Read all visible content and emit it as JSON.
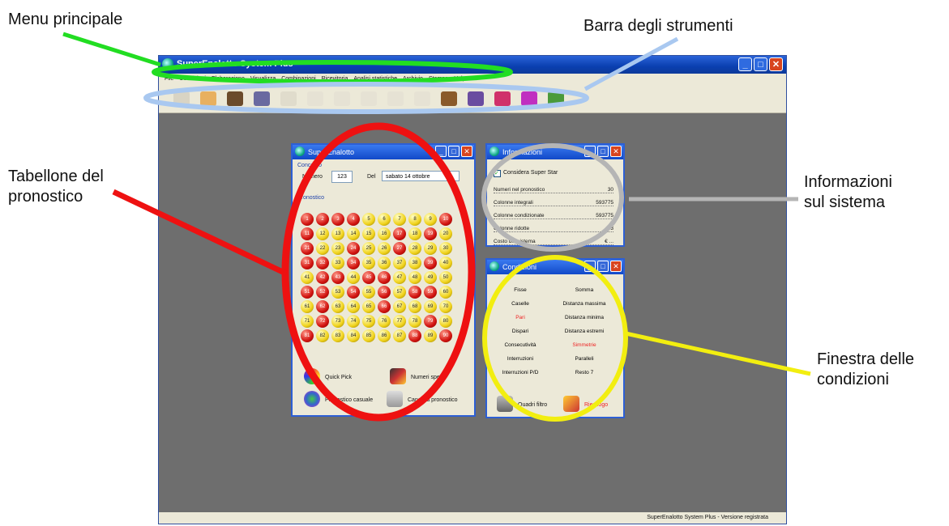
{
  "callouts": {
    "menu": "Menu principale",
    "toolbar": "Barra degli strumenti",
    "board_line1": "Tabellone del",
    "board_line2": "pronostico",
    "info_line1": "Informazioni",
    "info_line2": "sul sistema",
    "cond_line1": "Finestra delle",
    "cond_line2": "condizioni"
  },
  "colors": {
    "menu_highlight": "#22dd22",
    "toolbar_highlight": "#a9c8f0",
    "board_highlight": "#ee1111",
    "info_highlight": "#b5b5b5",
    "cond_highlight": "#f2ee10"
  },
  "app": {
    "title": "SuperEnalotto System Plus",
    "menu": [
      "File",
      "Condizioni",
      "Elaborazione",
      "Visualizza",
      "Combinazioni",
      "Ricevitoria",
      "Analisi statistiche",
      "Archivio",
      "Stampe",
      "Help"
    ],
    "toolbar_icons": [
      "open-icon",
      "hand-icon",
      "erase-icon",
      "books-icon",
      "filter-icon",
      "hand-outline-icon",
      "eraser-outline-icon",
      "shield-icon",
      "cup-icon",
      "cup2-icon",
      "box-icon",
      "books2-icon",
      "gift-icon",
      "calendar-icon",
      "chart-icon"
    ],
    "status": "SuperEnalotto System Plus - Versione registrata"
  },
  "prognosis": {
    "title": "SuperEnalotto",
    "section": "Concorso",
    "numero_label": "Numero",
    "numero_value": "123",
    "del_label": "Del",
    "date_value": "sabato  14  ottobre",
    "grid_label": "Pronostico",
    "selected": [
      1,
      2,
      3,
      4,
      10,
      11,
      17,
      19,
      21,
      24,
      27,
      31,
      32,
      34,
      39,
      42,
      43,
      45,
      46,
      51,
      52,
      54,
      56,
      58,
      59,
      62,
      66,
      72,
      79,
      81,
      88,
      90
    ],
    "actions": {
      "quick_pick": "Quick Pick",
      "numeri_speciali": "Numeri spec",
      "casuale": "Pronostico casuale",
      "cancella": "Cancella pronostico"
    }
  },
  "info": {
    "title": "Informazioni",
    "checkbox": "Considera Super Star",
    "rows": [
      {
        "label": "Numeri nel pronostico",
        "value": "30"
      },
      {
        "label": "Colonne integrali",
        "value": "593775"
      },
      {
        "label": "Colonne condizionate",
        "value": "593775"
      },
      {
        "label": "Colonne ridotte",
        "value": "93"
      },
      {
        "label": "Costo del sistema",
        "value": "€ ..."
      }
    ]
  },
  "conditions": {
    "title": "Condizioni",
    "items": [
      {
        "left": "Fisse",
        "right": "Somma"
      },
      {
        "left": "Caselle",
        "right": "Distanza massima"
      },
      {
        "left": "Pari",
        "right": "Distanza minima"
      },
      {
        "left": "Dispari",
        "right": "Distanza estremi"
      },
      {
        "left": "Consecutività",
        "right": "Simmetrie"
      },
      {
        "left": "Interruzioni",
        "right": "Paralleli"
      },
      {
        "left": "Interruzioni P/D",
        "right": "Resto 7"
      }
    ],
    "red_items": [
      "Pari",
      "Simmetrie"
    ],
    "quadri_filtro": "Quadri filtro",
    "riepilogo": "Riepilogo"
  }
}
